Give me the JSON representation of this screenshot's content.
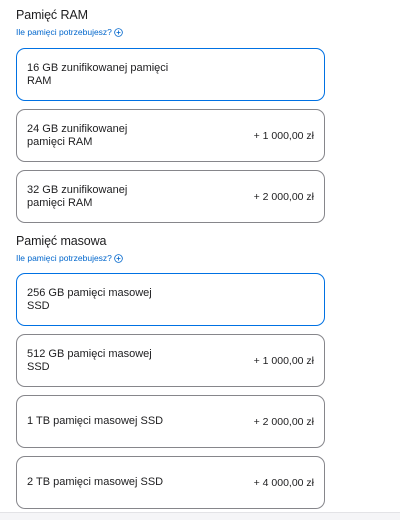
{
  "ram": {
    "title": "Pamięć RAM",
    "help_link": "Ile pamięci potrzebujesz?",
    "options": [
      {
        "line1": "16 GB zunifikowanej pamięci",
        "line2": "RAM",
        "price": ""
      },
      {
        "line1": "24 GB zunifikowanej",
        "line2": "pamięci RAM",
        "price": "+ 1 000,00 zł"
      },
      {
        "line1": "32 GB zunifikowanej",
        "line2": "pamięci RAM",
        "price": "+ 2 000,00 zł"
      }
    ]
  },
  "storage": {
    "title": "Pamięć masowa",
    "help_link": "Ile pamięci potrzebujesz?",
    "options": [
      {
        "line1": "256 GB pamięci masowej",
        "line2": "SSD",
        "price": ""
      },
      {
        "line1": "512 GB pamięci masowej",
        "line2": "SSD",
        "price": "+ 1 000,00 zł"
      },
      {
        "line1": "1 TB pamięci masowej SSD",
        "line2": "",
        "price": "+ 2 000,00 zł"
      },
      {
        "line1": "2 TB pamięci masowej SSD",
        "line2": "",
        "price": "+ 4 000,00 zł"
      }
    ]
  },
  "colors": {
    "link": "#0066cc",
    "selected_border": "#0071e3",
    "default_border": "#86868b"
  },
  "icons": {
    "help": "plus-circle-icon"
  }
}
